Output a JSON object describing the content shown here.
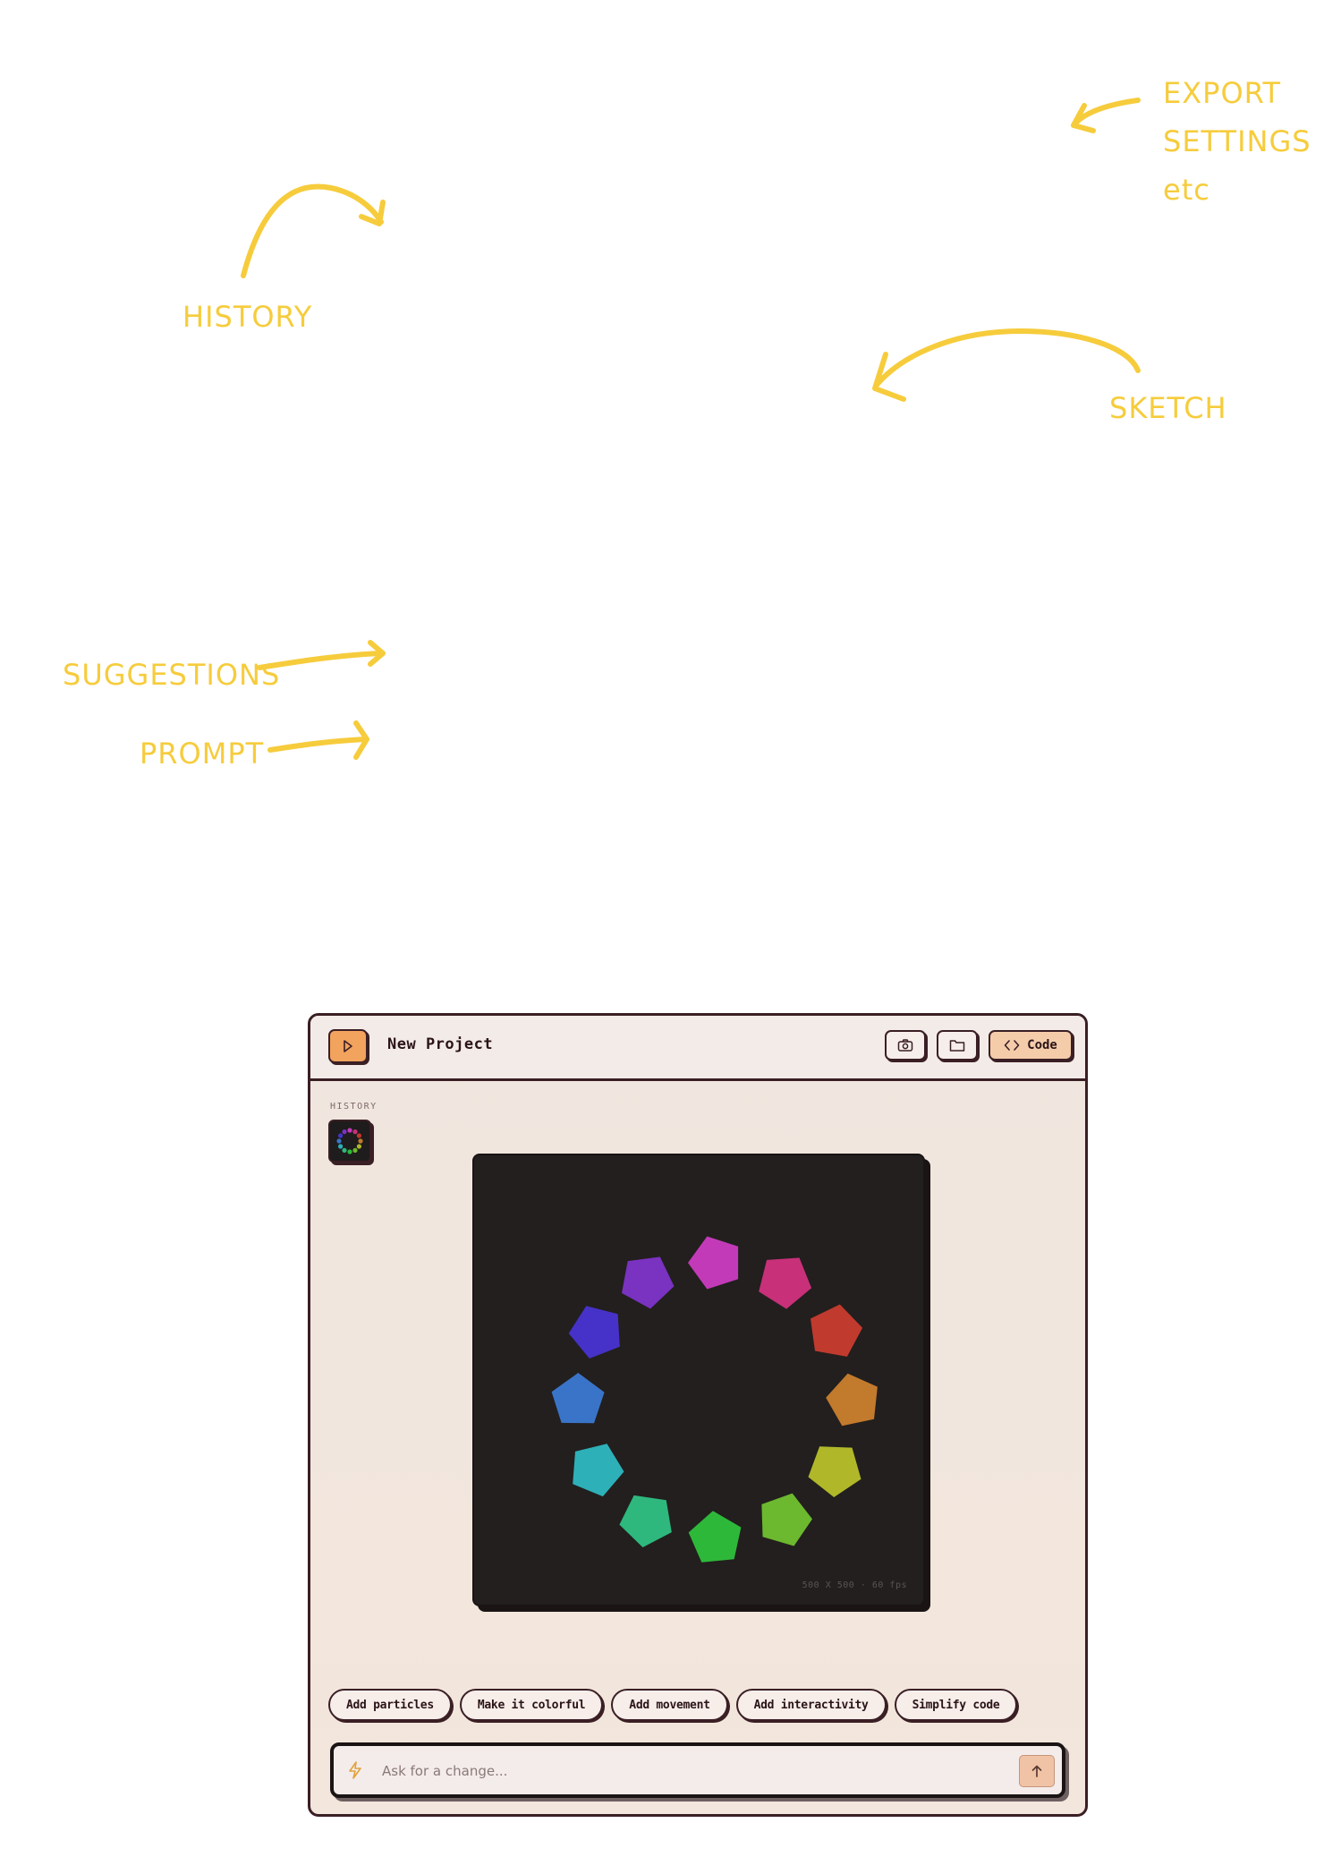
{
  "annotations": {
    "history": "HISTORY",
    "export": [
      "EXPORT",
      "SETTINGS",
      "etc"
    ],
    "sketch": "SKETCH",
    "suggestions": "SUGGESTIONS",
    "prompt": "PROMPT"
  },
  "header": {
    "project_title": "New Project",
    "code_label": "Code"
  },
  "history": {
    "label": "HISTORY"
  },
  "canvas": {
    "info": "500 X 500 · 60 fps",
    "shape_colors": [
      "#c33ab8",
      "#c8307a",
      "#c13a2e",
      "#c27a2c",
      "#b0b82a",
      "#6cb82e",
      "#2eb83a",
      "#2eb87e",
      "#2eb0b8",
      "#3a74c8",
      "#4632c8",
      "#7a32c0"
    ]
  },
  "suggestions": [
    "Add particles",
    "Make it colorful",
    "Add movement",
    "Add interactivity",
    "Simplify code"
  ],
  "prompt": {
    "placeholder": "Ask for a change...",
    "value": ""
  },
  "colors": {
    "annotation": "#f6cc3c",
    "play_button": "#f2a35d",
    "code_button": "#f5ccaa",
    "canvas_bg": "#221f1e"
  },
  "icons": {
    "play": "play-icon",
    "camera": "camera-icon",
    "folder": "folder-icon",
    "code": "code-icon",
    "bolt": "bolt-icon",
    "send": "arrow-up-icon"
  }
}
